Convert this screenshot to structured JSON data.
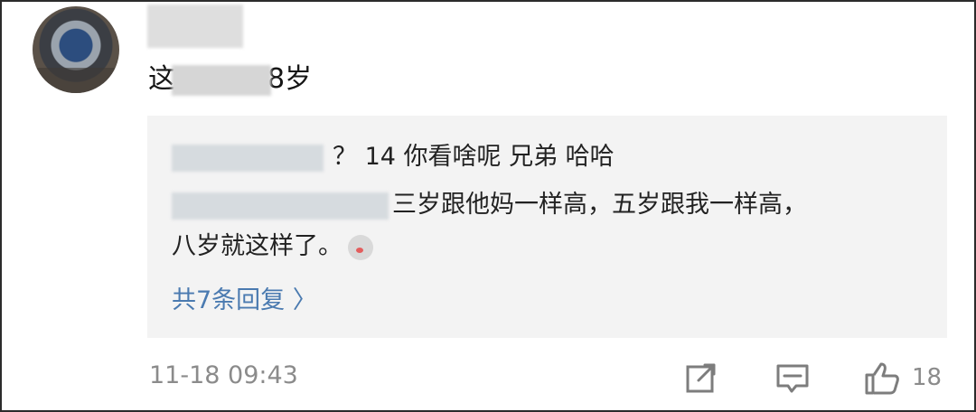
{
  "comment": {
    "text_prefix": "这",
    "text_suffix": "8岁"
  },
  "replies": [
    {
      "text": "？ 14 你看啥呢 兄弟 哈哈"
    },
    {
      "text": "三岁跟他妈一样高，五岁跟我一样高，",
      "continuation": "八岁就这样了。"
    }
  ],
  "more_replies_label": "共7条回复 〉",
  "timestamp": "11-18 09:43",
  "like_count": "18",
  "icons": {
    "share": "share-icon",
    "comment": "comment-icon",
    "like": "thumbs-up-icon",
    "emoji": "husky-emoji-icon"
  }
}
